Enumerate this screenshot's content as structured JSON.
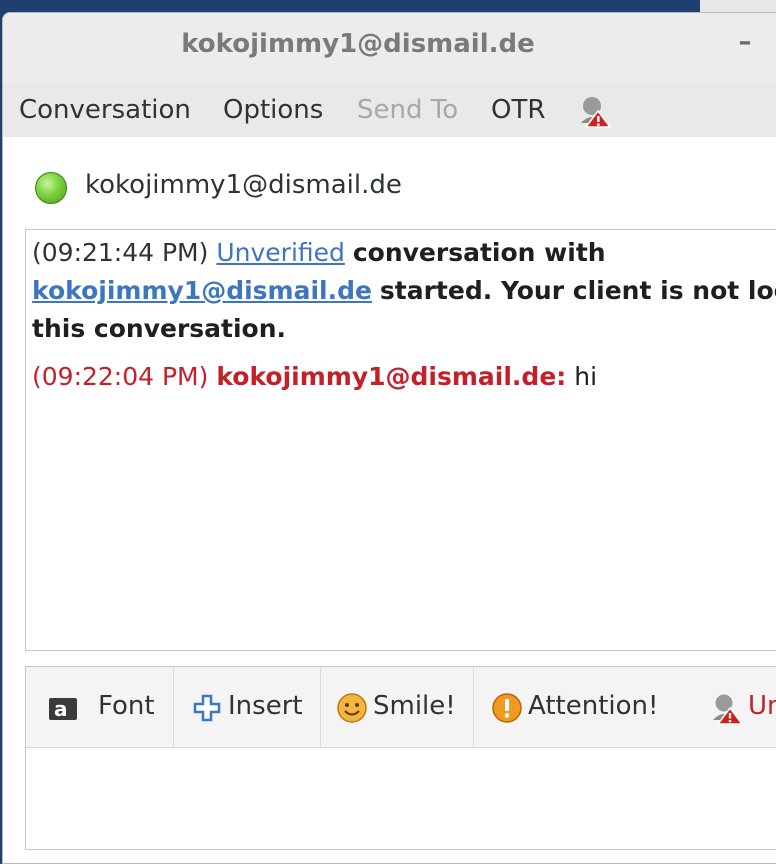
{
  "window": {
    "title": "kokojimmy1@dismail.de",
    "minimize_label": "–"
  },
  "menubar": {
    "items": [
      {
        "label": "Conversation"
      },
      {
        "label": "Options"
      },
      {
        "label": "Send To"
      },
      {
        "label": "OTR"
      }
    ]
  },
  "buddy": {
    "name": "kokojimmy1@dismail.de",
    "status": "available",
    "status_color": "#7cd13d"
  },
  "history": {
    "messages": [
      {
        "timestamp": "(09:21:44 PM)",
        "link_text": "Unverified",
        "text1": "conversation with",
        "link2": "kokojimmy1@dismail.de",
        "text2": "started.  Your client is not logging",
        "text3": "this conversation."
      },
      {
        "timestamp": "(09:22:04 PM)",
        "sender": "kokojimmy1@dismail.de:",
        "text": "hi",
        "sender_color": "#c4202a"
      }
    ]
  },
  "toolbar": {
    "buttons": [
      {
        "label": "Font",
        "icon": "font-icon"
      },
      {
        "label": "Insert",
        "icon": "insert-plus-icon"
      },
      {
        "label": "Smile!",
        "icon": "smiley-icon"
      },
      {
        "label": "Attention!",
        "icon": "attention-icon"
      },
      {
        "label": "Unverified",
        "icon": "otr-unverified-icon"
      }
    ]
  },
  "colors": {
    "link": "#3d76c0",
    "received": "#c4202a"
  }
}
